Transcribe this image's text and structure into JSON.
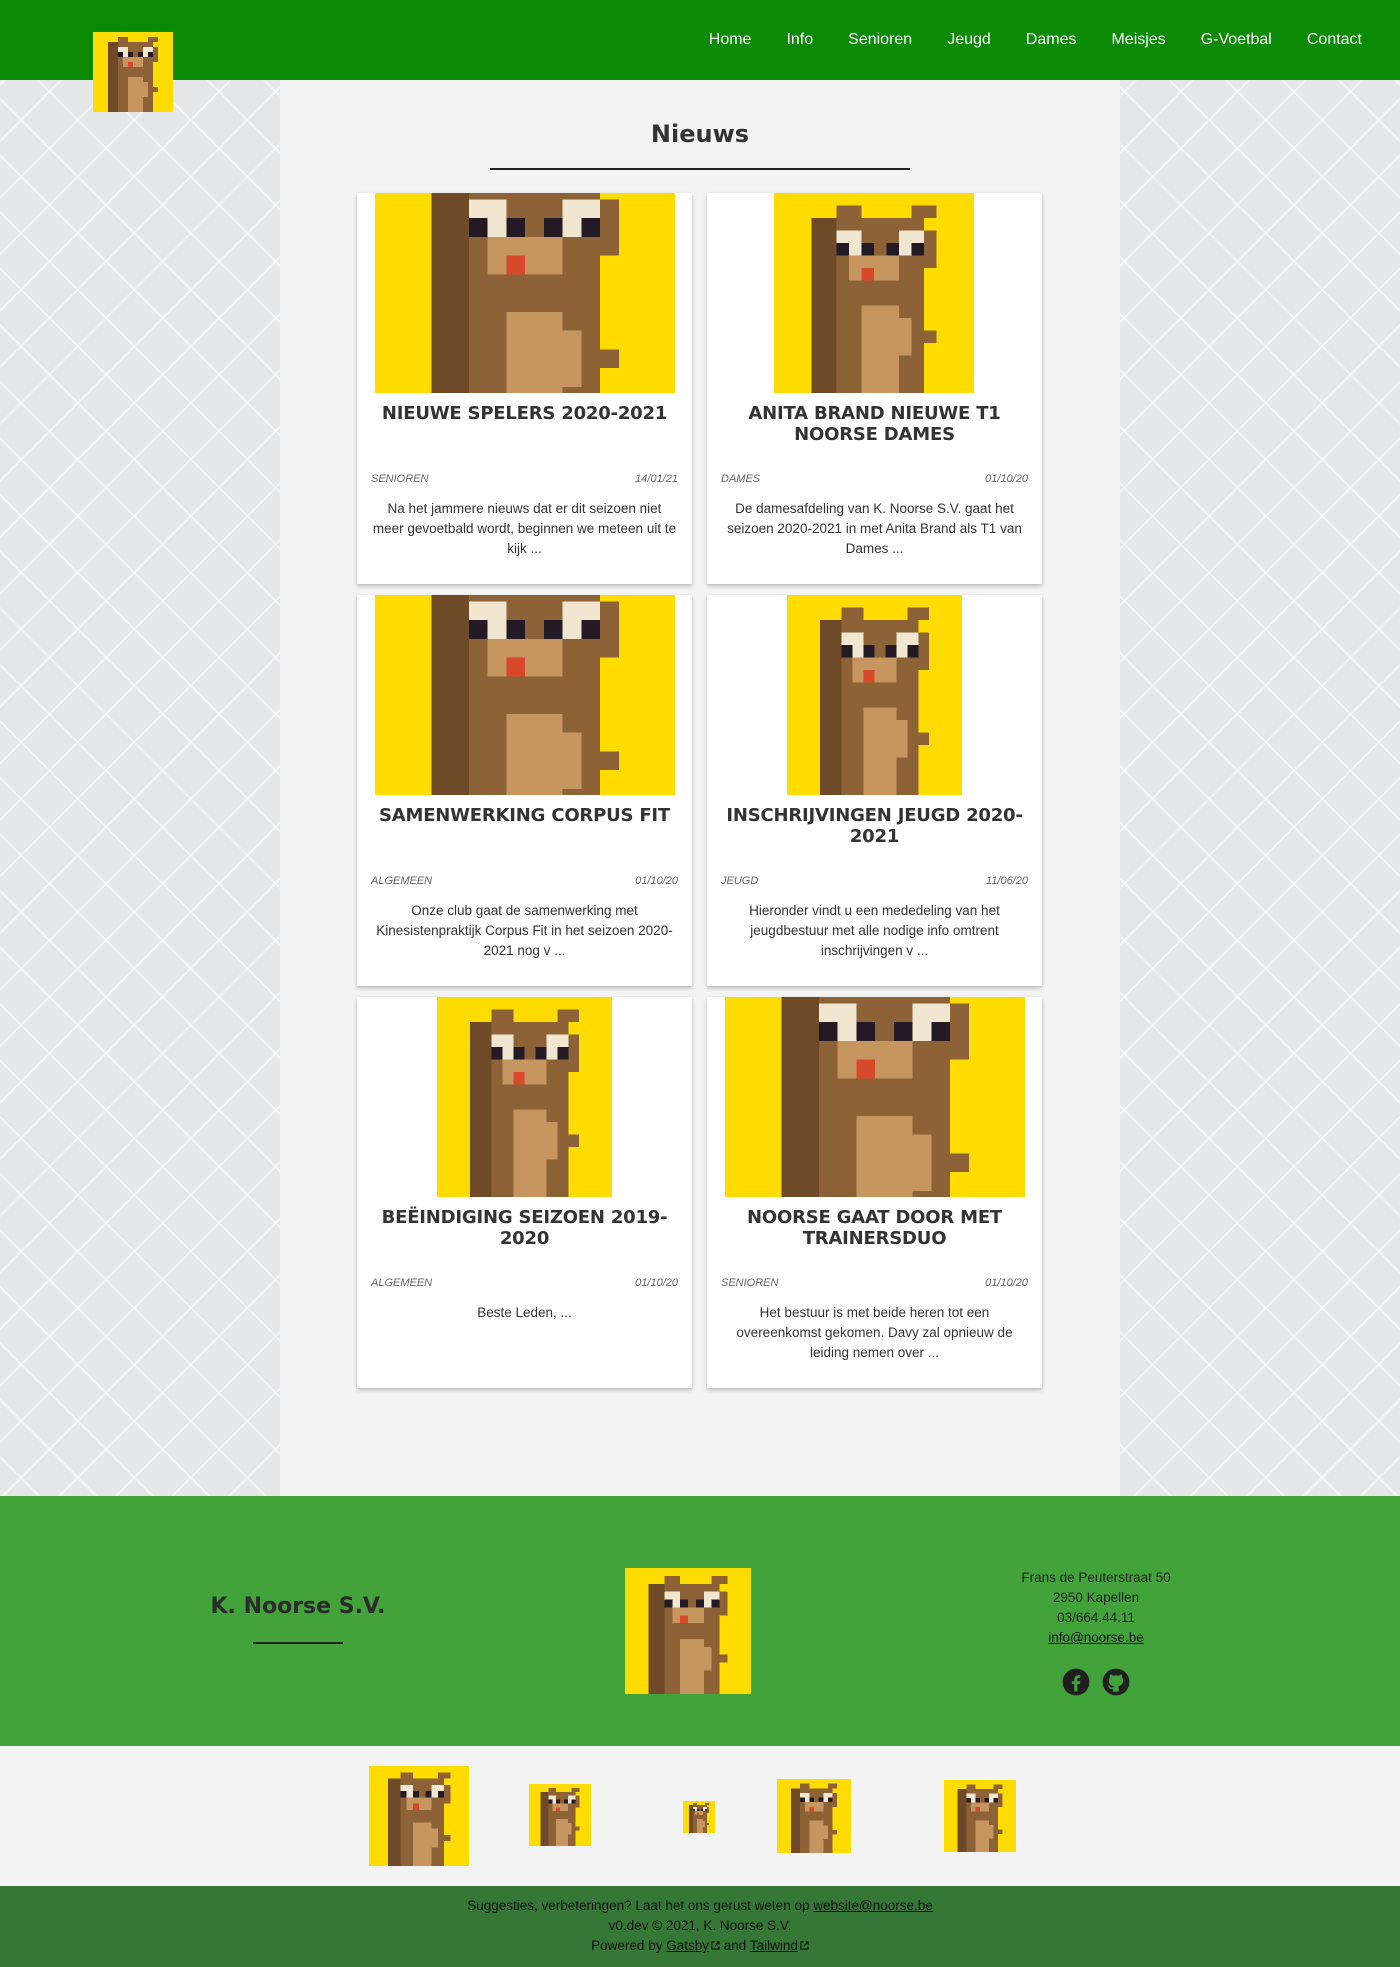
{
  "nav": {
    "items": [
      "Home",
      "Info",
      "Senioren",
      "Jeugd",
      "Dames",
      "Meisjes",
      "G-Voetbal",
      "Contact"
    ]
  },
  "page": {
    "title": "Nieuws"
  },
  "articles": [
    {
      "title": "NIEUWE SPELERS 2020-2021",
      "category": "SENIOREN",
      "date": "14/01/21",
      "excerpt": "Na het jammere nieuws dat er dit seizoen niet meer gevoetbald wordt, beginnen we meteen uit te kijk ..."
    },
    {
      "title": "ANITA BRAND NIEUWE T1 NOORSE DAMES",
      "category": "DAMES",
      "date": "01/10/20",
      "excerpt": "De damesafdeling van K. Noorse S.V. gaat het seizoen 2020-2021 in met Anita Brand als T1 van Dames ..."
    },
    {
      "title": "SAMENWERKING CORPUS FIT",
      "category": "ALGEMEEN",
      "date": "01/10/20",
      "excerpt": "Onze club gaat de samenwerking met Kinesistenpraktijk Corpus Fit in het seizoen 2020-2021 nog v ..."
    },
    {
      "title": "INSCHRIJVINGEN JEUGD 2020-2021",
      "category": "JEUGD",
      "date": "11/06/20",
      "excerpt": "Hieronder vindt u een mededeling van het jeugdbestuur met alle nodige info omtrent inschrijvingen v ..."
    },
    {
      "title": "BEËINDIGING SEIZOEN 2019-2020",
      "category": "ALGEMEEN",
      "date": "01/10/20",
      "excerpt": "Beste Leden,    ..."
    },
    {
      "title": "NOORSE GAAT DOOR MET TRAINERSDUO",
      "category": "SENIOREN",
      "date": "01/10/20",
      "excerpt": "Het bestuur is met beide heren tot een overeenkomst gekomen. Davy zal opnieuw de leiding nemen over ..."
    }
  ],
  "footer": {
    "club_name": "K. Noorse S.V.",
    "address_street": "Frans de Peuterstraat 50",
    "address_city": "2950 Kapellen",
    "phone": "03/664.44.11",
    "email": "info@noorse.be",
    "social_icons": [
      "facebook-icon",
      "github-icon"
    ]
  },
  "bottom": {
    "suggestion_text": "Suggesties, verbeteringen? Laat het ons gerust weten op",
    "suggestion_email": "website@noorse.be",
    "version_line": "v0.dev © 2021, K. Noorse S.V.",
    "powered_prefix": "Powered by",
    "powered_gatsby": "Gatsby",
    "powered_and": "and",
    "powered_tailwind": "Tailwind"
  },
  "colors": {
    "header_green": "#0b8a06",
    "footer_green": "#42a33b",
    "bottom_green": "#357836",
    "logo_yellow": "#ffdc00"
  }
}
